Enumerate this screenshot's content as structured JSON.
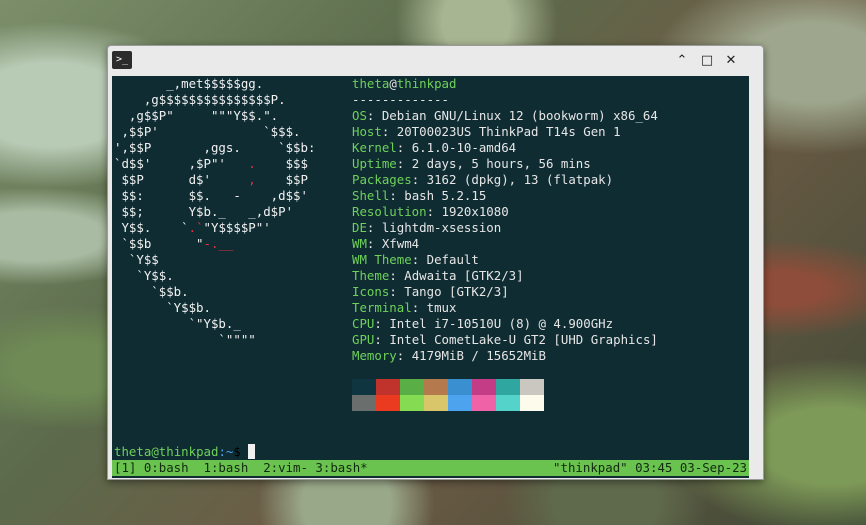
{
  "window": {
    "app_icon": "terminal-icon",
    "controls": {
      "minimize": "⌃",
      "maximize": "□",
      "close": "✕"
    }
  },
  "ascii_logo": [
    "       _,met$$$$$gg.",
    "    ,g$$$$$$$$$$$$$$$P.",
    "  ,g$$P\"     \"\"\"Y$$.\".",
    " ,$$P'              `$$$.",
    "',$$P       ,ggs.     `$$b:",
    "`d$$'     ,$P\"'   .    $$$",
    " $$P      d$'     ,    $$P",
    " $$:      $$.   -    ,d$$'",
    " $$;      Y$b._   _,d$P'",
    " Y$$.    `.`\"Y$$$$P\"'",
    " `$$b      \"-.__",
    "  `Y$$",
    "   `Y$$.",
    "     `$$b.",
    "       `Y$$b.",
    "          `\"Y$b._",
    "              `\"\"\"\""
  ],
  "fetch": {
    "user": "theta",
    "at": "@",
    "host": "thinkpad",
    "separator": "-------------",
    "fields": [
      {
        "label": "OS",
        "value": "Debian GNU/Linux 12 (bookworm) x86_64"
      },
      {
        "label": "Host",
        "value": "20T00023US ThinkPad T14s Gen 1"
      },
      {
        "label": "Kernel",
        "value": "6.1.0-10-amd64"
      },
      {
        "label": "Uptime",
        "value": "2 days, 5 hours, 56 mins"
      },
      {
        "label": "Packages",
        "value": "3162 (dpkg), 13 (flatpak)"
      },
      {
        "label": "Shell",
        "value": "bash 5.2.15"
      },
      {
        "label": "Resolution",
        "value": "1920x1080"
      },
      {
        "label": "DE",
        "value": "lightdm-xsession"
      },
      {
        "label": "WM",
        "value": "Xfwm4"
      },
      {
        "label": "WM Theme",
        "value": "Default"
      },
      {
        "label": "Theme",
        "value": "Adwaita [GTK2/3]"
      },
      {
        "label": "Icons",
        "value": "Tango [GTK2/3]"
      },
      {
        "label": "Terminal",
        "value": "tmux"
      },
      {
        "label": "CPU",
        "value": "Intel i7-10510U (8) @ 4.900GHz"
      },
      {
        "label": "GPU",
        "value": "Intel CometLake-U GT2 [UHD Graphics]"
      },
      {
        "label": "Memory",
        "value": "4179MiB / 15652MiB"
      }
    ]
  },
  "palette": {
    "normal": [
      "#0f3540",
      "#c0322c",
      "#5aae46",
      "#b5794e",
      "#3a8fd0",
      "#c43c86",
      "#2fa7a0",
      "#c9c7c0"
    ],
    "bright": [
      "#6a6f6e",
      "#ea3b21",
      "#85dc52",
      "#d9c66b",
      "#4ea3ee",
      "#ef62a8",
      "#53d3c9",
      "#fdfbeb"
    ]
  },
  "prompt": {
    "user": "theta",
    "at": "@",
    "host": "thinkpad",
    "path": ":~",
    "symbol": "$"
  },
  "tmux": {
    "left": "[1] 0:bash  1:bash  2:vim- 3:bash*",
    "right": "\"thinkpad\" 03:45 03-Sep-23"
  }
}
